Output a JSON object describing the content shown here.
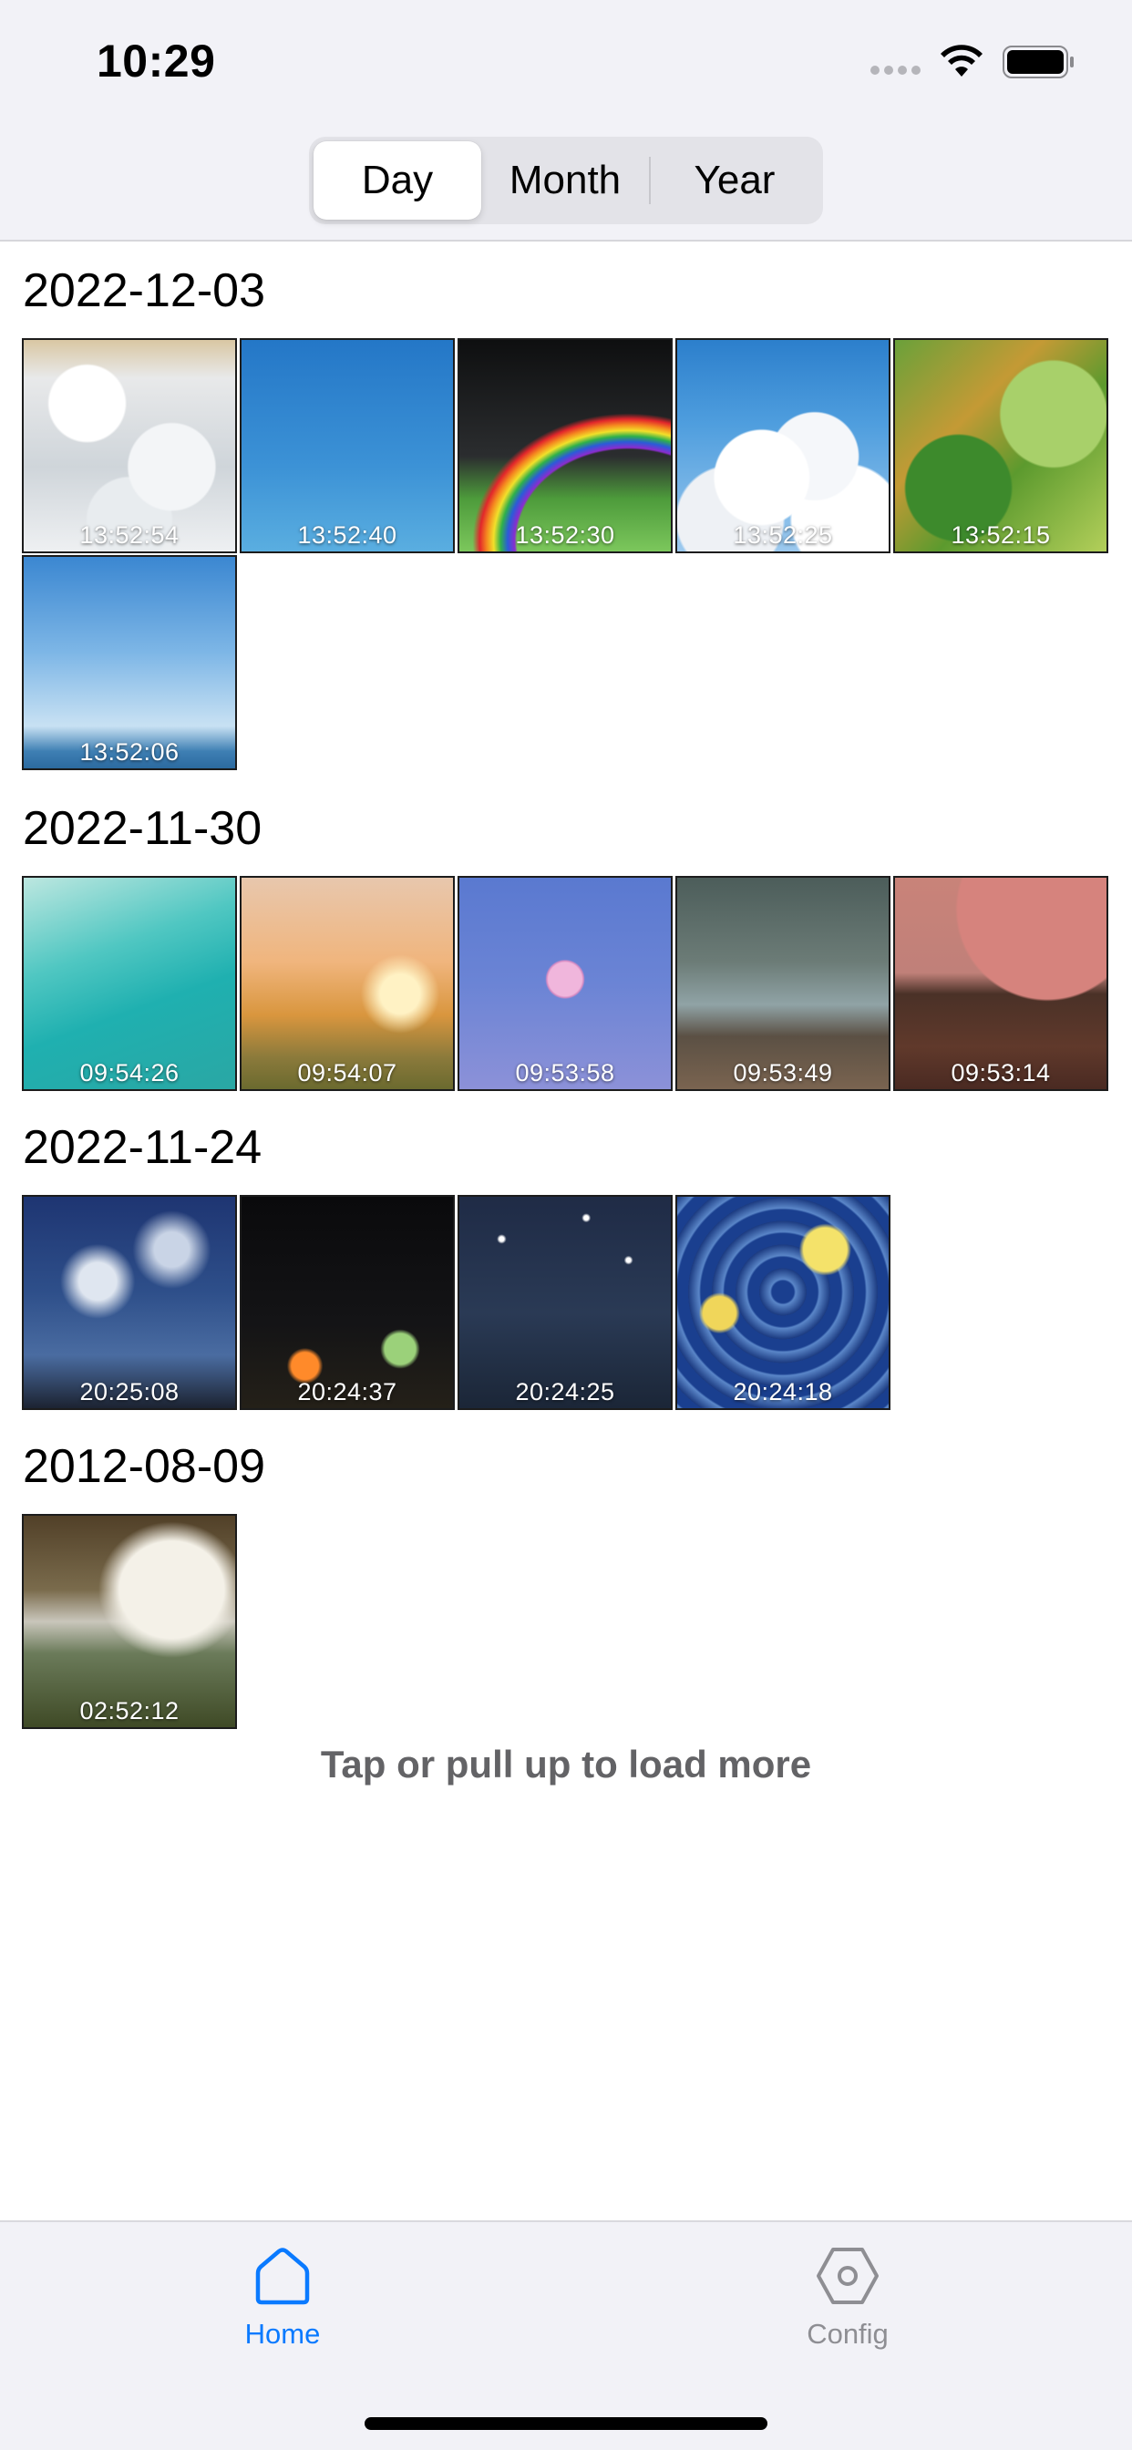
{
  "status_bar": {
    "time": "10:29"
  },
  "segmented": {
    "options": [
      {
        "label": "Day",
        "selected": true
      },
      {
        "label": "Month",
        "selected": false
      },
      {
        "label": "Year",
        "selected": false
      }
    ]
  },
  "groups": [
    {
      "date": "2022-12-03",
      "items": [
        {
          "time": "13:52:54",
          "style": "p-waves"
        },
        {
          "time": "13:52:40",
          "style": "p-blue"
        },
        {
          "time": "13:52:30",
          "style": "p-rainbow"
        },
        {
          "time": "13:52:25",
          "style": "p-clouds"
        },
        {
          "time": "13:52:15",
          "style": "p-green"
        },
        {
          "time": "13:52:06",
          "style": "p-poles"
        }
      ]
    },
    {
      "date": "2022-11-30",
      "items": [
        {
          "time": "09:54:26",
          "style": "p-teal"
        },
        {
          "time": "09:54:07",
          "style": "p-house"
        },
        {
          "time": "09:53:58",
          "style": "p-moon"
        },
        {
          "time": "09:53:49",
          "style": "p-beach"
        },
        {
          "time": "09:53:14",
          "style": "p-sunset"
        }
      ]
    },
    {
      "date": "2022-11-24",
      "items": [
        {
          "time": "20:25:08",
          "style": "p-sky-night"
        },
        {
          "time": "20:24:37",
          "style": "p-tents"
        },
        {
          "time": "20:24:25",
          "style": "p-stars"
        },
        {
          "time": "20:24:18",
          "style": "p-starry"
        }
      ]
    },
    {
      "date": "2012-08-09",
      "items": [
        {
          "time": "02:52:12",
          "style": "p-waterfall"
        }
      ]
    }
  ],
  "load_more": "Tap or pull up to load more",
  "tab_bar": {
    "home_label": "Home",
    "config_label": "Config",
    "active": "Home",
    "active_color": "#0a7aff",
    "inactive_color": "#8e8e93"
  }
}
